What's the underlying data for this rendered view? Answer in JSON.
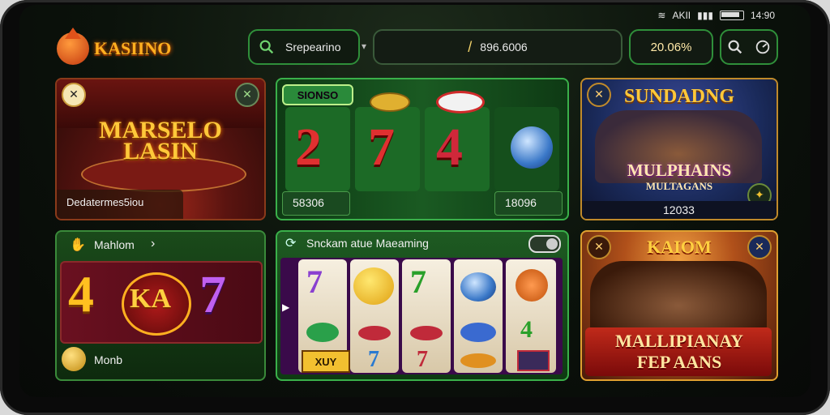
{
  "status": {
    "carrier": "AKII",
    "time": "14:90"
  },
  "header": {
    "logo_text": "KASIINO",
    "search_label": "Srepearino",
    "balance_value": "896.6006",
    "percent_value": "20.06%",
    "icons": {
      "search": "search-icon",
      "settings": "settings-icon"
    }
  },
  "cards": {
    "marsello": {
      "title_line1": "MARSELO",
      "title_line2": "LASIN",
      "caption": "Dedatermes5iou"
    },
    "slot_green": {
      "label_top": "SIONSO",
      "amount_left": "58306",
      "amount_right": "18096",
      "symbols": [
        "2",
        "7",
        "4"
      ]
    },
    "sundang": {
      "title": "SUNDADNG",
      "subtitle": "MULPHAINS",
      "subtitle2": "MULTAGANS",
      "amount": "12033"
    },
    "mahlom": {
      "label": "Mahlom",
      "chevron": "›",
      "big_left": "4",
      "big_mid": "KA",
      "big_right": "7",
      "footer": "Monb"
    },
    "reels_panel": {
      "title": "Snckam atue Maeaming",
      "tag": "XUY",
      "symbols_col2": [
        "7",
        "7",
        "7"
      ]
    },
    "kaiom": {
      "title": "KAIOM",
      "subtitle": "MALLIPIANAY",
      "subtitle2": "FEP AANS"
    }
  },
  "colors": {
    "accent_green": "#2f8f3a",
    "gold": "#ffb020",
    "red": "#c0162a"
  }
}
